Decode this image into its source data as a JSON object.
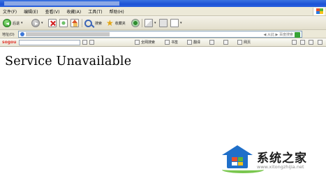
{
  "menubar": {
    "items": [
      "文件(F)",
      "编辑(E)",
      "查看(V)",
      "收藏(A)",
      "工具(T)",
      "帮助(H)"
    ]
  },
  "toolbar": {
    "back_label": "后退",
    "search_label": "搜索",
    "favorites_label": "收藏夹"
  },
  "address": {
    "label": "地址(D)",
    "right_hint": "◀ 从此 ▶ 百度搜索"
  },
  "links_bar": {
    "brand": "sogou",
    "items": [
      "全网搜索",
      "书签",
      "翻译",
      "网页"
    ]
  },
  "content": {
    "message": "Service Unavailable"
  },
  "watermark": {
    "name": "系统之家",
    "url": "www.xitongzhijia.net"
  },
  "colors": {
    "titlebar": "#1c52d6",
    "chrome": "#ece9d8",
    "watermark_blue": "#1f6fc9",
    "watermark_green": "#7ac74f"
  }
}
